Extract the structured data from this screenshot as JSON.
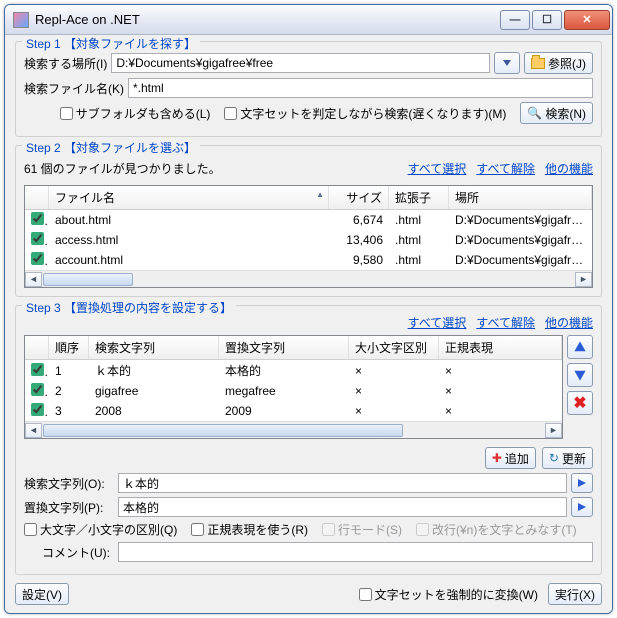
{
  "window": {
    "title": "Repl-Ace on .NET"
  },
  "step1": {
    "title": "Step 1 【対象ファイルを探す】",
    "path_label": "検索する場所(I)",
    "path_value": "D:¥Documents¥gigafree¥free",
    "browse": "参照(J)",
    "pattern_label": "検索ファイル名(K)",
    "pattern_value": "*.html",
    "subfolder": "サブフォルダも含める(L)",
    "charset_detect": "文字セットを判定しながら検索(遅くなります)(M)",
    "search": "検索(N)"
  },
  "step2": {
    "title": "Step 2 【対象ファイルを選ぶ】",
    "found": "61 個のファイルが見つかりました。",
    "sel_all": "すべて選択",
    "sel_none": "すべて解除",
    "other": "他の機能",
    "cols": {
      "name": "ファイル名",
      "size": "サイズ",
      "ext": "拡張子",
      "place": "場所"
    },
    "rows": [
      {
        "name": "about.html",
        "size": "6,674",
        "ext": ".html",
        "place": "D:¥Documents¥gigafree¥free"
      },
      {
        "name": "access.html",
        "size": "13,406",
        "ext": ".html",
        "place": "D:¥Documents¥gigafree¥free"
      },
      {
        "name": "account.html",
        "size": "9,580",
        "ext": ".html",
        "place": "D:¥Documents¥gigafree¥free"
      }
    ]
  },
  "step3": {
    "title": "Step 3 【置換処理の内容を設定する】",
    "sel_all": "すべて選択",
    "sel_none": "すべて解除",
    "other": "他の機能",
    "cols": {
      "order": "順序",
      "find": "検索文字列",
      "replace": "置換文字列",
      "case": "大小文字区別",
      "regex": "正規表現"
    },
    "rows": [
      {
        "order": "1",
        "find": "ｋ本的",
        "replace": "本格的",
        "case": "×",
        "regex": "×"
      },
      {
        "order": "2",
        "find": "gigafree",
        "replace": "megafree",
        "case": "×",
        "regex": "×"
      },
      {
        "order": "3",
        "find": "2008",
        "replace": "2009",
        "case": "×",
        "regex": "×"
      }
    ],
    "add": "追加",
    "update": "更新",
    "find_label": "検索文字列(O):",
    "find_value": "ｋ本的",
    "replace_label": "置換文字列(P):",
    "replace_value": "本格的",
    "case_opt": "大文字／小文字の区別(Q)",
    "regex_opt": "正規表現を使う(R)",
    "line_opt": "行モード(S)",
    "crlf_opt": "改行(¥n)を文字とみなす(T)",
    "comment_label": "コメント(U):",
    "comment_value": ""
  },
  "bottom": {
    "settings": "設定(V)",
    "force_charset": "文字セットを強制的に変換(W)",
    "run": "実行(X)"
  }
}
